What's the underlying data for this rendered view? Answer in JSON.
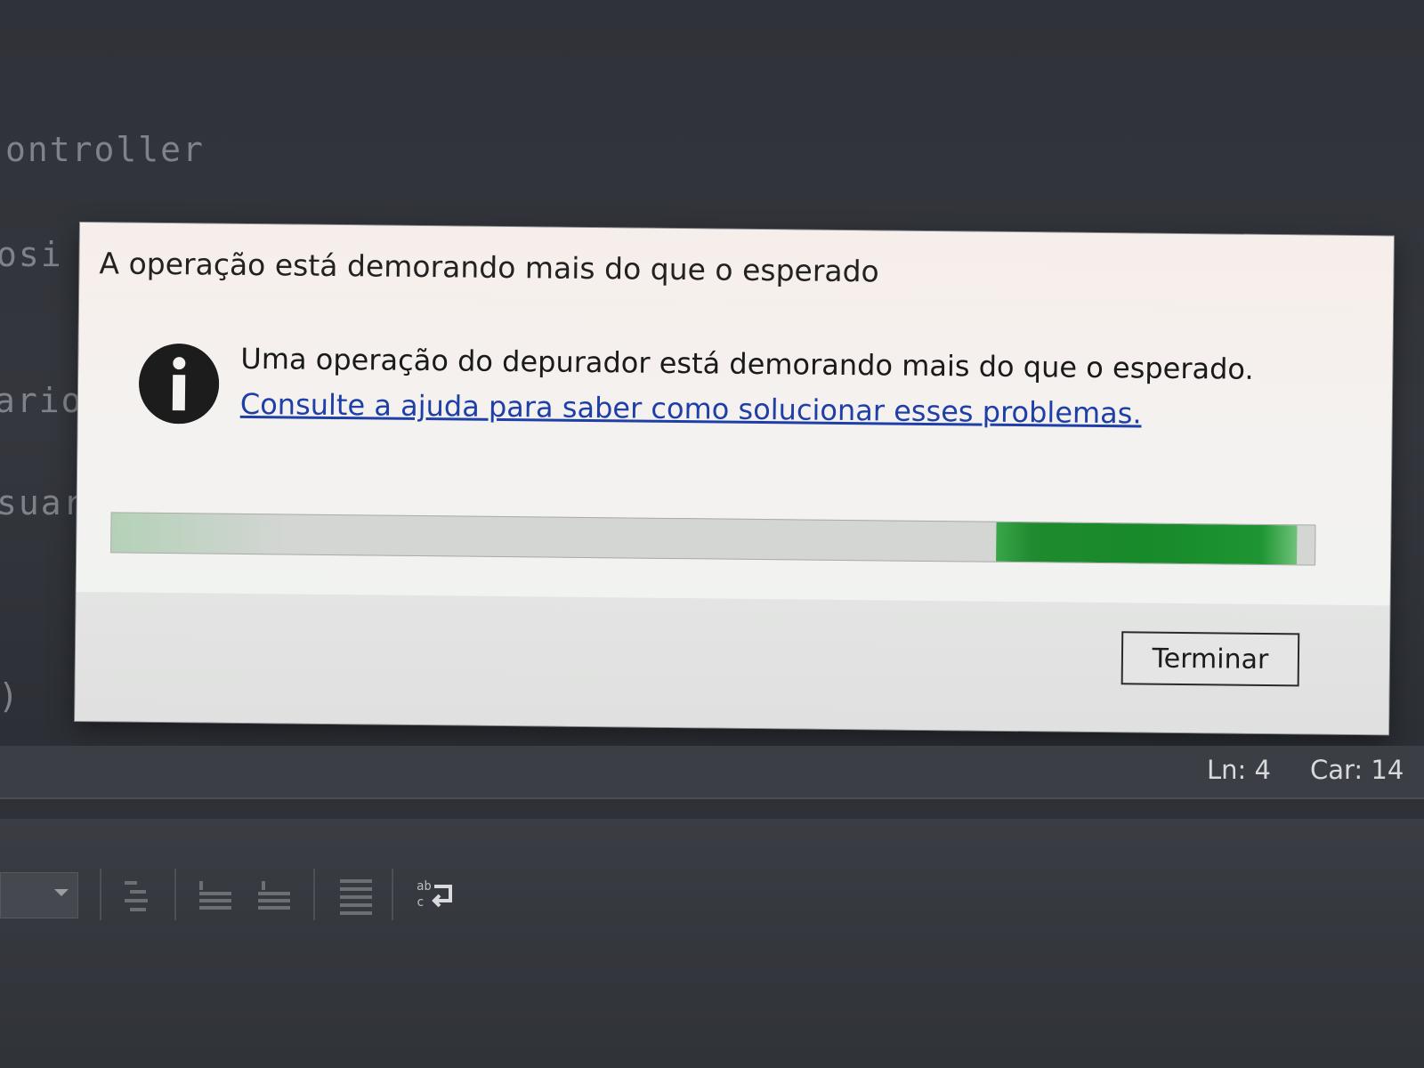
{
  "editor": {
    "code_fragments": [
      "ontroller",
      "osi",
      "ario",
      "suar",
      ")"
    ]
  },
  "dialog": {
    "title": "A operação está demorando mais do que o esperado",
    "message": "Uma operação do depurador está demorando mais do que o esperado.",
    "help_link": "Consulte a ajuda para saber como solucionar esses problemas.",
    "icon": "info-icon",
    "progress": {
      "type": "marquee",
      "fill_start_fraction": 0.735,
      "fill_end_fraction": 0.985,
      "color": "#178a2a"
    },
    "terminate_button": "Terminar"
  },
  "status_bar": {
    "line": "Ln: 4",
    "char": "Car: 14"
  },
  "toolbar": {
    "icons": [
      "dropdown-combo",
      "indent-icon",
      "decrease-indent-icon",
      "increase-indent-icon",
      "align-lines-icon",
      "word-wrap-icon"
    ]
  }
}
